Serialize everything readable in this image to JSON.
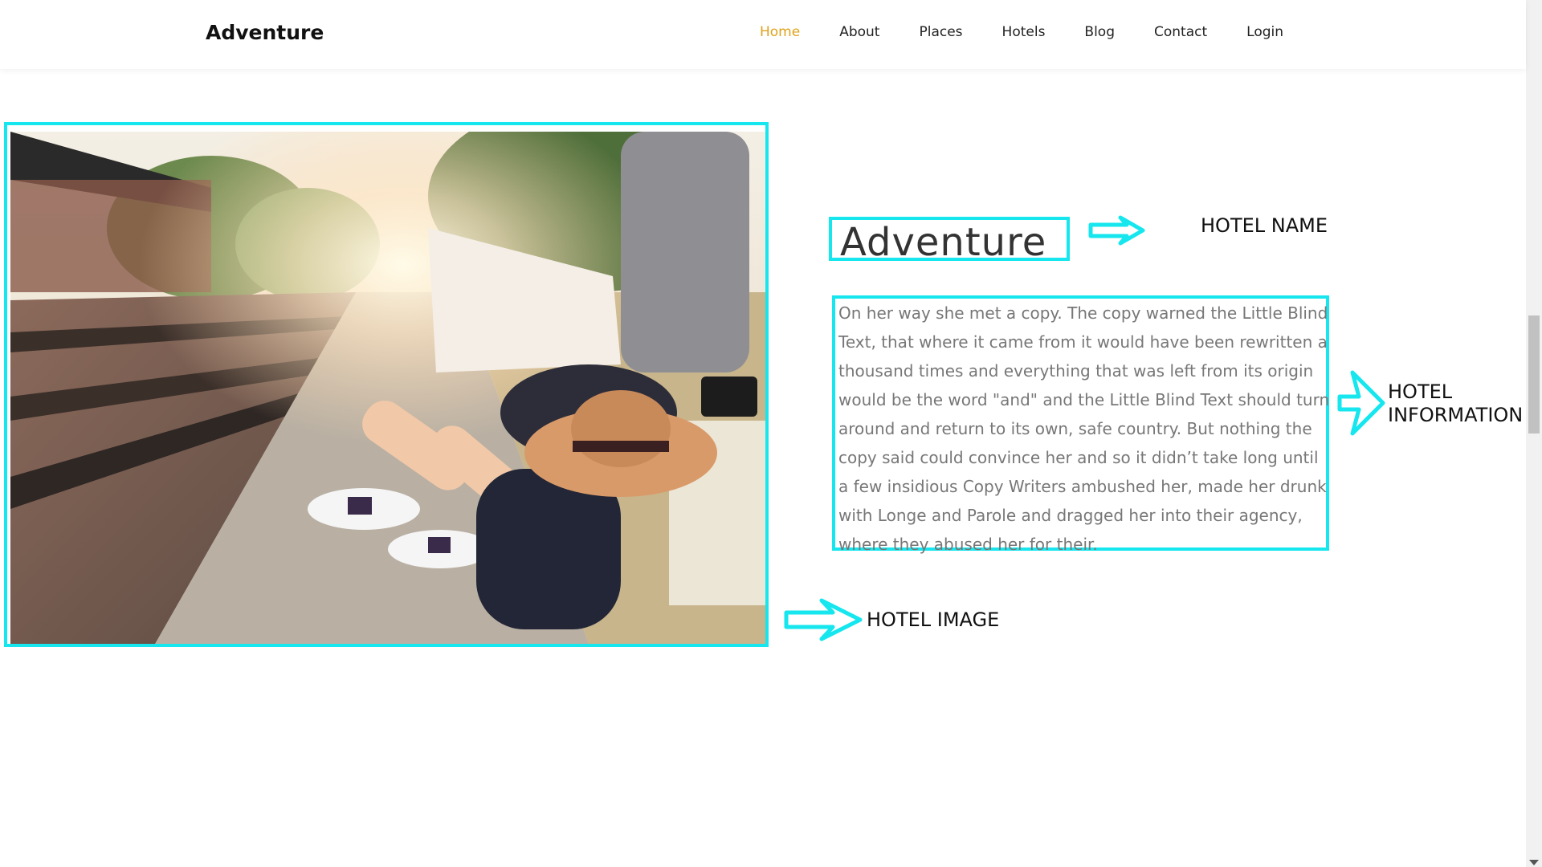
{
  "navbar": {
    "brand": "Adventure",
    "links": [
      "Home",
      "About",
      "Places",
      "Hotels",
      "Blog",
      "Contact",
      "Login"
    ],
    "active": "Home"
  },
  "hotel": {
    "name": "Adventure",
    "info": "On her way she met a copy. The copy warned the Little Blind Text, that where it came from it would have been rewritten a thousand times and everything that was left from its origin would be the word \"and\" and the Little Blind Text should turn around and return to its own, safe country. But nothing the copy said could convince her and so it didn’t take long until a few insidious Copy Writers ambushed her, made her drunk with Longe and Parole and dragged her into their agency, where they abused her for their."
  },
  "annotations": {
    "name_label": "HOTEL NAME",
    "info_label_line1": "HOTEL",
    "info_label_line2": "INFORMATION",
    "image_label": "HOTEL IMAGE"
  },
  "colors": {
    "annotation": "#16e6ee",
    "nav_active": "#e0a21c"
  },
  "icons": {
    "arrow": "arrow-right-icon",
    "chevron": "chevron-right-icon"
  }
}
